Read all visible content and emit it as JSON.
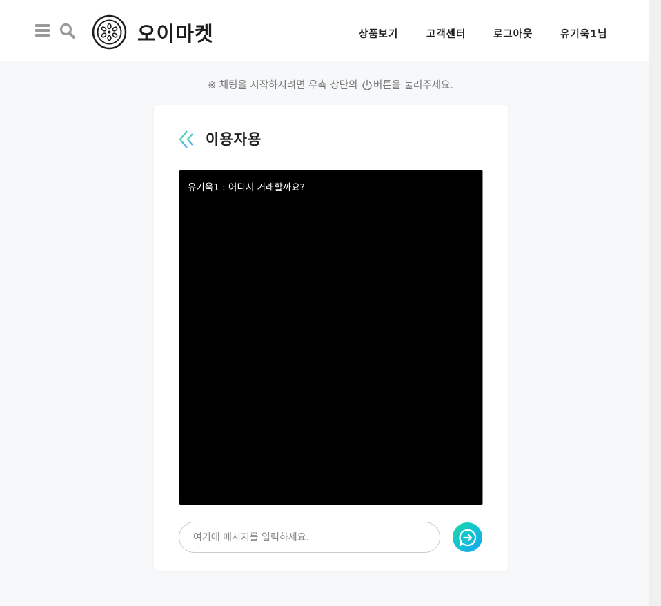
{
  "header": {
    "brand": "오이마켓",
    "nav": [
      {
        "label": "상품보기"
      },
      {
        "label": "고객센터"
      },
      {
        "label": "로그아웃"
      },
      {
        "label": "유기욱1님"
      }
    ]
  },
  "notice": {
    "before": "※ 채팅을 시작하시려면 우측 상단의 ",
    "after": "버튼을 눌러주세요."
  },
  "chat": {
    "title": "이용자용",
    "messages": [
      {
        "text": "유기욱1 : 어디서 거래할까요?"
      }
    ],
    "input_placeholder": "여기에 메시지를 입력하세요.",
    "input_value": ""
  },
  "colors": {
    "accent_start": "#1ed9a5",
    "accent_end": "#1ea0f0",
    "chat_background": "#000000"
  },
  "icons": [
    "menu-icon",
    "search-icon",
    "cucumber-logo-icon",
    "power-icon",
    "chevron-left-icon",
    "send-chat-icon"
  ]
}
